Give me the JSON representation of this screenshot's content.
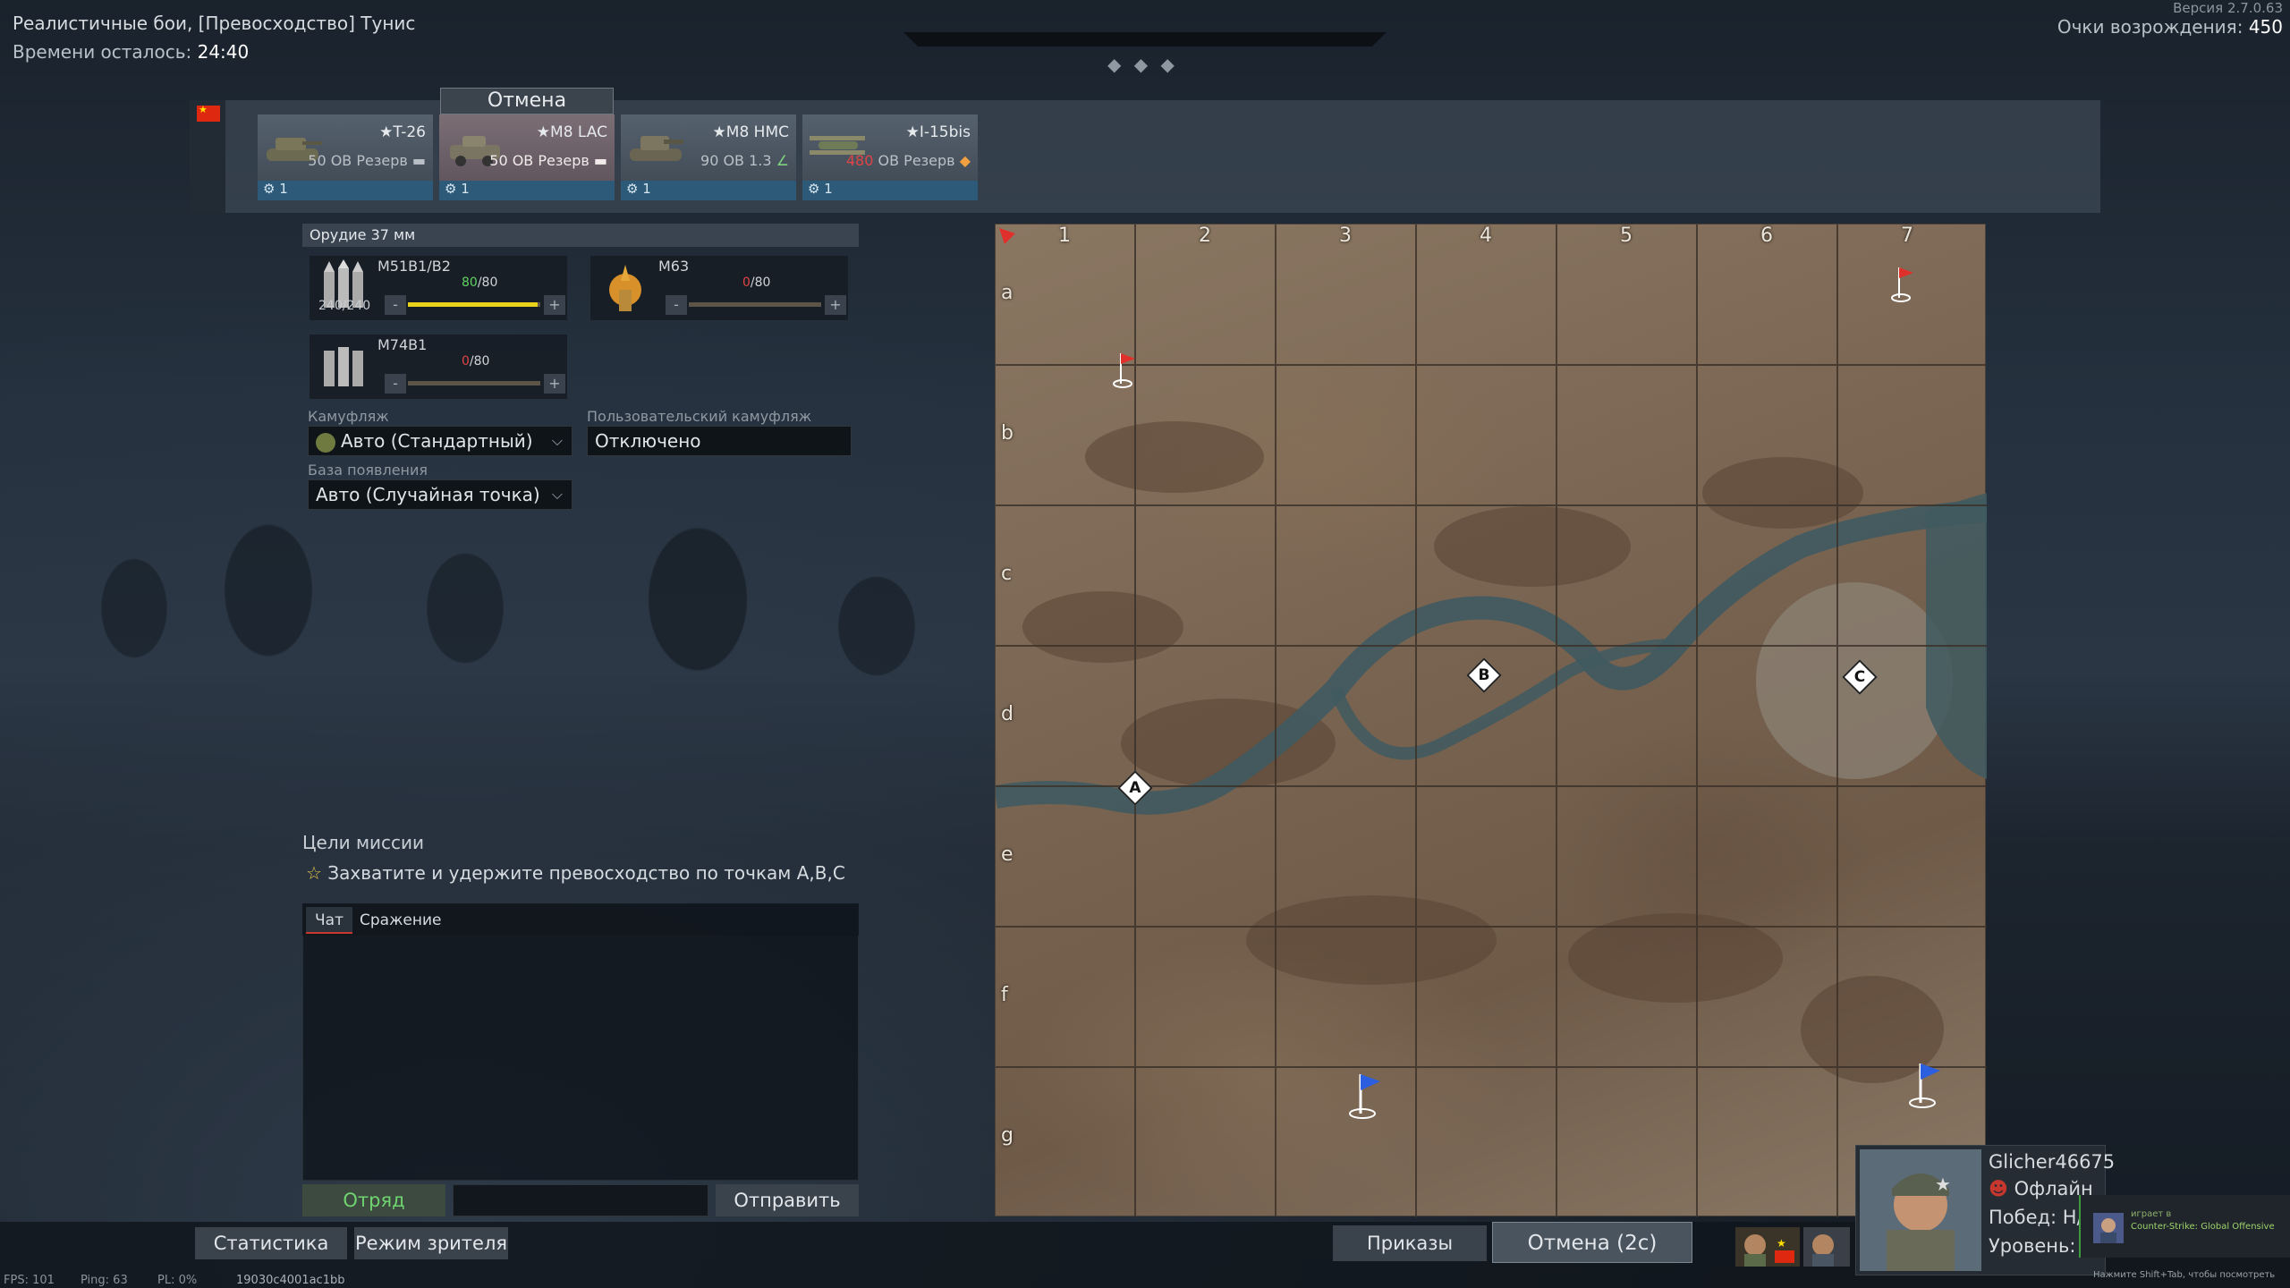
{
  "header": {
    "battle_title": "Реалистичные бои, [Превосходство] Тунис",
    "time_left_label": "Времени осталось:",
    "time_left_value": "24:40",
    "version": "Версия 2.7.0.63",
    "respawn_label": "Очки возрождения:",
    "respawn_value": "450",
    "indicator_diamonds": "◆ ◆ ◆"
  },
  "vehicles": {
    "cancel_tab": "Отмена",
    "items": [
      {
        "name": "★T-26",
        "info": "50 ОВ Резерв",
        "crew": "1"
      },
      {
        "name": "★M8 LAC",
        "info": "50 ОВ Резерв",
        "crew": "1"
      },
      {
        "name": "★M8 HMC",
        "info": "90 ОВ 1.3",
        "crew": "1"
      },
      {
        "name": "★I-15bis",
        "info_red": "480",
        "info": " ОВ Резерв",
        "crew": "1"
      }
    ]
  },
  "weapon": {
    "header": "Орудие 37 мм",
    "shells": [
      {
        "name": "M51B1/B2",
        "count": "80",
        "max": "/80",
        "stock": "240/240",
        "fill": 0.98
      },
      {
        "name": "M63",
        "count": "0",
        "max": "/80",
        "fill": 0
      },
      {
        "name": "M74B1",
        "count": "0",
        "max": "/80",
        "fill": 0
      }
    ],
    "minus": "-",
    "plus": "+"
  },
  "settings": {
    "camo_label": "Камуфляж",
    "camo_value": "Авто (Стандартный)",
    "custom_camo_label": "Пользовательский камуфляж",
    "custom_camo_value": "Отключено",
    "spawn_label": "База появления",
    "spawn_value": "Авто (Случайная точка)"
  },
  "mission": {
    "title": "Цели миссии",
    "objective": "Захватите и удержите превосходство по точкам",
    "points": "A,B,C"
  },
  "chat": {
    "tab_chat": "Чат",
    "tab_battle": "Сражение",
    "squad_button": "Отряд",
    "send_button": "Отправить"
  },
  "map": {
    "columns": [
      "1",
      "2",
      "3",
      "4",
      "5",
      "6",
      "7"
    ],
    "rows": [
      "a",
      "b",
      "c",
      "d",
      "e",
      "f",
      "g"
    ],
    "capture_points": [
      "A",
      "B",
      "C"
    ]
  },
  "bottom": {
    "stats_button": "Статистика",
    "spectator_button": "Режим зрителя",
    "orders_button": "Приказы",
    "cancel_button": "Отмена (2с)",
    "fps": "FPS: 101",
    "ping": "Ping: 63",
    "pl": "PL: 0%",
    "session": "19030c4001ac1bb"
  },
  "profile": {
    "username": "Glicher46675",
    "status": "Офлайн",
    "wins": "Побед: Н/",
    "level": "Уровень: I"
  },
  "toast": {
    "playing": "играет в",
    "game": "Counter-Strike: Global Offensive",
    "hint": "Нажмите Shift+Tab, чтобы посмотреть"
  },
  "colors": {
    "red_flag": "#e0302b",
    "blue_flag": "#2b5fe0",
    "ammo_fill": "#e8d21c",
    "count_full": "#5fd35f",
    "count_empty": "#e04545"
  }
}
